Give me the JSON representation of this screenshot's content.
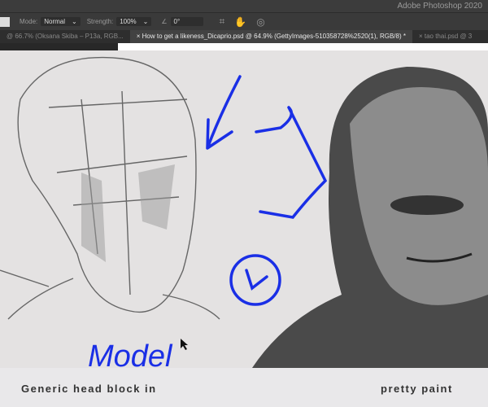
{
  "app": {
    "title": "Adobe Photoshop 2020"
  },
  "options": {
    "mode_label": "Mode:",
    "mode_value": "Normal",
    "strength_label": "Strength:",
    "strength_value": "100%",
    "angle_value": "0°"
  },
  "tabs": [
    {
      "label": "@ 66.7% (Oksana Skiba – P13a, RGB..."
    },
    {
      "label": "How to get a likeness_Dicaprio.psd @ 64.9% (GettyImages-510358728%2520(1), RGB/8) *",
      "active": true
    },
    {
      "label": "tao thai.psd @ 3"
    }
  ],
  "canvas": {
    "caption_left": "Generic head block in",
    "caption_right": "pretty paint",
    "handwriting": "Model",
    "annotation_color": "#1a2fe6"
  }
}
